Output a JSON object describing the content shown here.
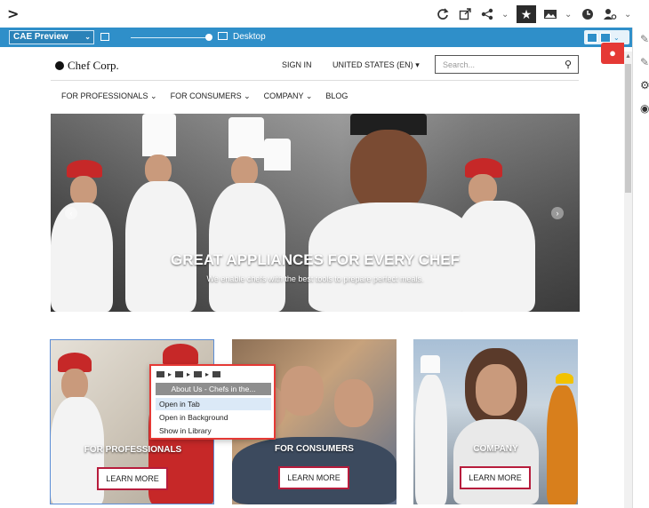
{
  "toolbar": {
    "back_glyph": ">",
    "icons": [
      "reload-icon",
      "open-external-icon",
      "share-icon",
      "bookmark-star-icon",
      "image-icon",
      "history-icon",
      "user-settings-icon"
    ]
  },
  "preview_bar": {
    "mode_select": "CAE Preview",
    "device_label": "Desktop",
    "slider_value": 1.0,
    "accent": "#2f8fc9"
  },
  "site": {
    "logo": "Chef Corp.",
    "sign_in": "SIGN IN",
    "region": "UNITED STATES (EN)",
    "search_placeholder": "Search...",
    "nav": [
      {
        "label": "FOR PROFESSIONALS",
        "has_menu": true
      },
      {
        "label": "FOR CONSUMERS",
        "has_menu": true
      },
      {
        "label": "COMPANY",
        "has_menu": true
      },
      {
        "label": "BLOG",
        "has_menu": false
      }
    ],
    "hero": {
      "title": "GREAT APPLIANCES FOR EVERY CHEF",
      "subtitle": "We enable chefs with the best tools to prepare perfect meals."
    },
    "cards": [
      {
        "title": "FOR PROFESSIONALS",
        "button": "LEARN MORE"
      },
      {
        "title": "FOR CONSUMERS",
        "button": "LEARN MORE"
      },
      {
        "title": "COMPANY",
        "button": "LEARN MORE"
      }
    ]
  },
  "context_menu": {
    "header": "About Us - Chefs in the...",
    "items": [
      "Open in Tab",
      "Open in Background",
      "Show in Library"
    ],
    "active_index": 0
  },
  "colors": {
    "brand_red": "#e53935",
    "button_border": "#b71c3c"
  }
}
